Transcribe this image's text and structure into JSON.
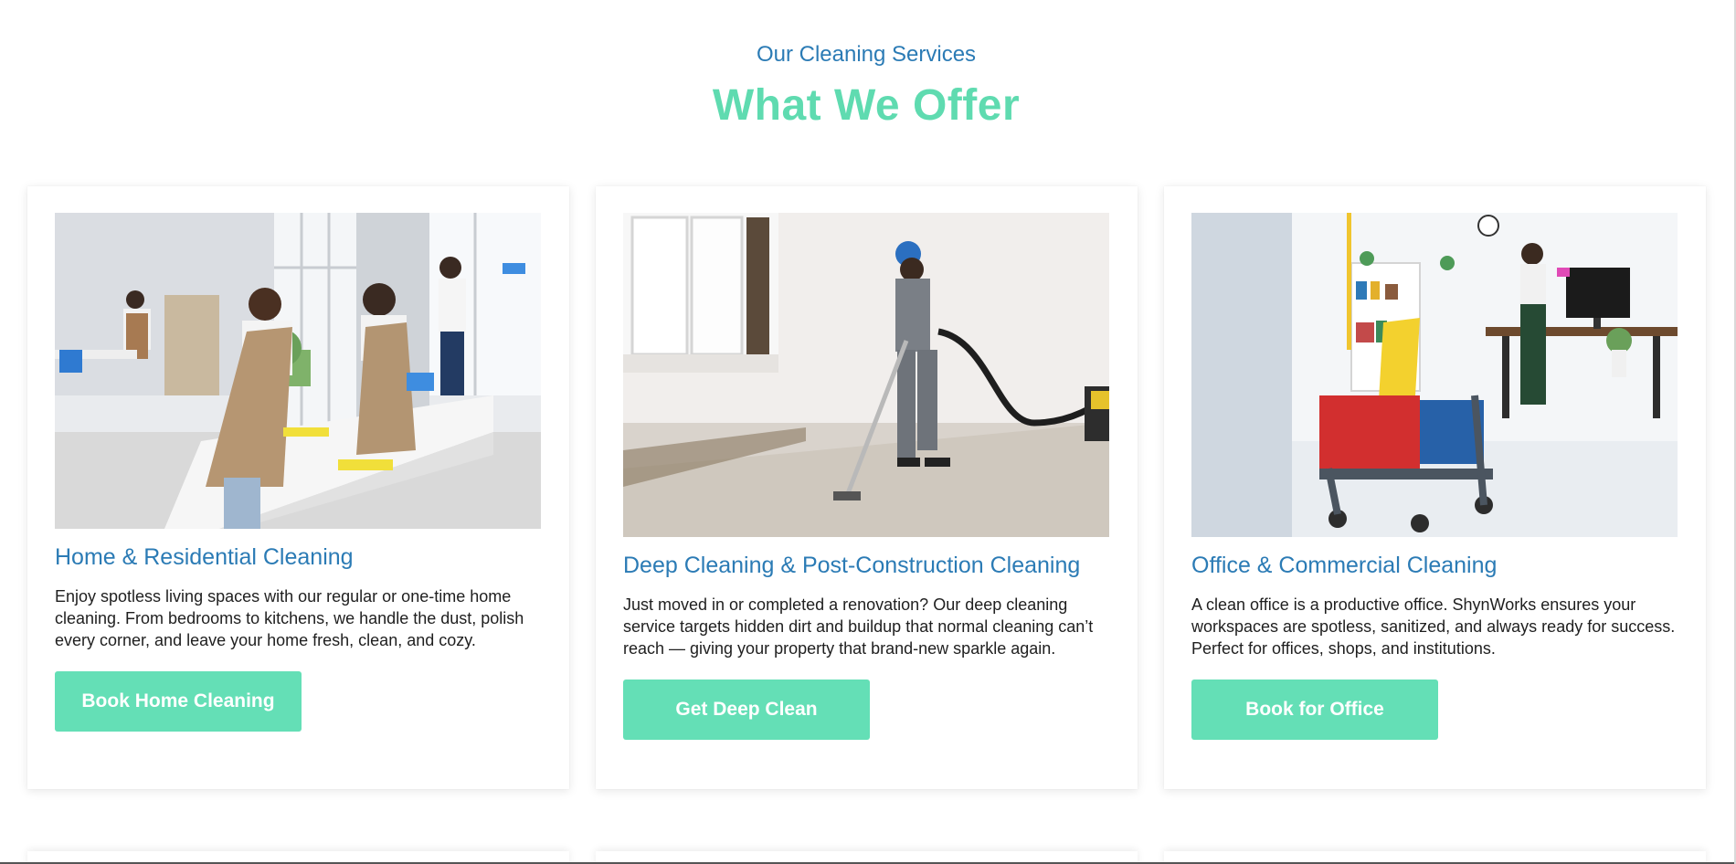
{
  "section": {
    "subtitle": "Our Cleaning Services",
    "title": "What We Offer"
  },
  "colors": {
    "accent_blue": "#2b7bb5",
    "accent_green": "#5fdbb0",
    "button_bg": "#64dfb6"
  },
  "cards": [
    {
      "image_alt": "Team cleaning a bright home kitchen",
      "title": "Home & Residential Cleaning",
      "description": "Enjoy spotless living spaces with our regular or one-time home cleaning. From bedrooms to kitchens, we handle the dust, polish every corner, and leave your home fresh, clean, and cozy.",
      "button": "Book Home Cleaning"
    },
    {
      "image_alt": "Worker vacuuming a room after renovation",
      "title": "Deep Cleaning & Post-Construction Cleaning",
      "description": "Just moved in or completed a renovation? Our deep cleaning service targets hidden dirt and buildup that normal cleaning can’t reach — giving your property that brand-new sparkle again.",
      "button": "Get Deep Clean"
    },
    {
      "image_alt": "Cleaning cart in a modern office",
      "title": "Office & Commercial Cleaning",
      "description": "A clean office is a productive office. ShynWorks ensures your workspaces are spotless, sanitized, and always ready for success. Perfect for offices, shops, and institutions.",
      "button": "Book for Office"
    }
  ]
}
